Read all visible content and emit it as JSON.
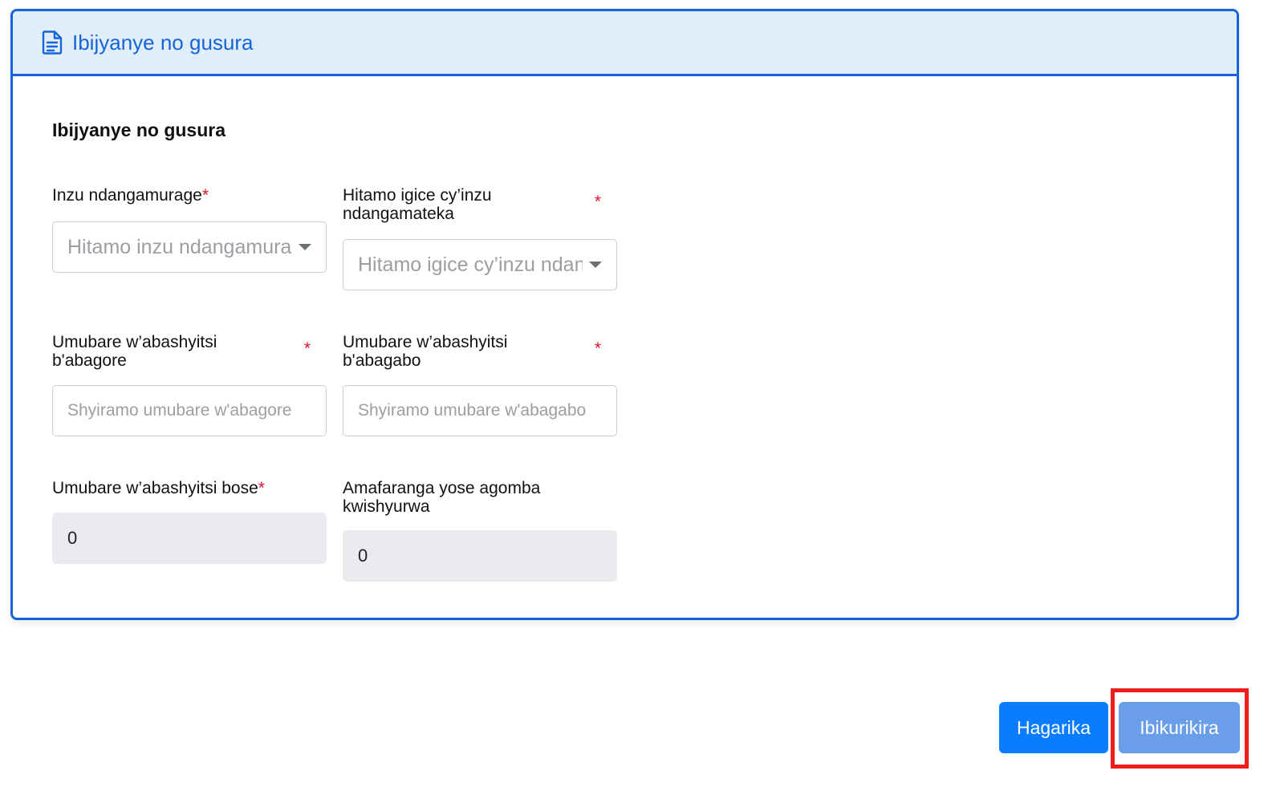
{
  "panel": {
    "header_title": "Ibijyanye no gusura",
    "header_icon": "document-icon",
    "section_title": "Ibijyanye no gusura"
  },
  "fields": {
    "museum": {
      "label": "Inzu ndangamurage",
      "required": "*",
      "placeholder": "Hitamo inzu ndangamurage"
    },
    "museum_section": {
      "label_line1": "Hitamo igice cy’inzu",
      "label_line2": "ndangamateka",
      "required": "*",
      "placeholder": "Hitamo igice cy’inzu ndangamateka"
    },
    "female_visitors": {
      "label_line1": "Umubare w’abashyitsi",
      "label_line2": "b'abagore",
      "required": "*",
      "placeholder": "Shyiramo umubare w'abagore"
    },
    "male_visitors": {
      "label_line1": "Umubare w’abashyitsi",
      "label_line2": "b'abagabo",
      "required": "*",
      "placeholder": "Shyiramo umubare w'abagabo"
    },
    "total_visitors": {
      "label": "Umubare w’abashyitsi bose",
      "required": "*",
      "value": "0"
    },
    "total_amount": {
      "label_line1": "Amafaranga yose agomba",
      "label_line2": "kwishyurwa",
      "value": "0"
    }
  },
  "actions": {
    "cancel_label": "Hagarika",
    "next_label": "Ibikurikira"
  },
  "colors": {
    "accent": "#1565d8",
    "header_bg": "#e1edf9",
    "required": "#e0102c",
    "cancel_bg": "#0a7cff",
    "next_bg": "#6a9ee8",
    "highlight": "#f01d1d"
  }
}
